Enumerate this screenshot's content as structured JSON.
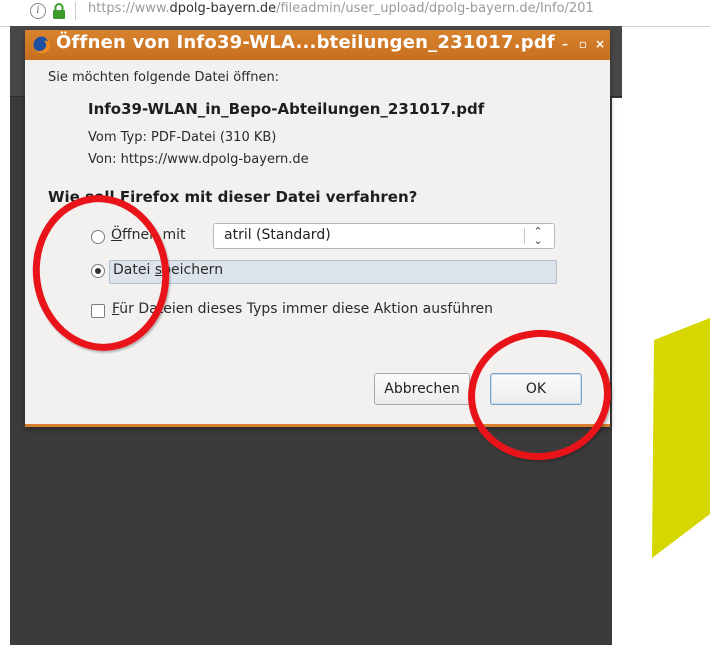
{
  "browser": {
    "url_prefix": "https://www.",
    "url_domain": "dpolg-bayern.de",
    "url_path": "/fileadmin/user_upload/dpolg-bayern.de/Info/201"
  },
  "dialog": {
    "title": "Öffnen von Info39-WLA...bteilungen_231017.pdf",
    "prompt": "Sie möchten folgende Datei öffnen:",
    "filename": "Info39-WLAN_in_Bepo-Abteilungen_231017.pdf",
    "filetype": "Vom Typ: PDF-Datei (310 KB)",
    "source": "Von: https://www.dpolg-bayern.de",
    "question": "Wie soll Firefox mit dieser Datei verfahren?",
    "open_with": {
      "label_accel": "Ö",
      "label_rest": "ffnen mit",
      "selected_app": "atril (Standard)",
      "checked": false
    },
    "save_file": {
      "label_pre": "Datei ",
      "label_accel": "s",
      "label_post": "peichern",
      "checked": true
    },
    "always_action": {
      "label_accel": "F",
      "label_rest": "ür Dateien dieses Typs immer diese Aktion ausführen",
      "checked": false
    },
    "cancel_label": "Abbrechen",
    "ok_label": "OK"
  },
  "colors": {
    "titlebar": "#d8832e",
    "annotation": "#e8141a",
    "pdf_shape": "#d6d600"
  }
}
